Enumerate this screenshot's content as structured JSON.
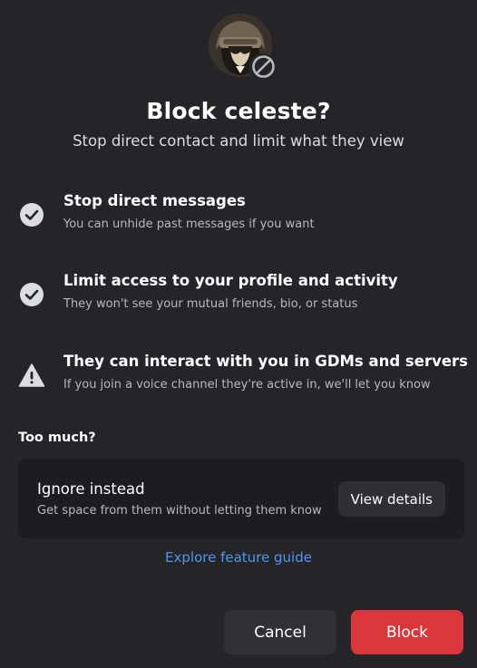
{
  "dialog": {
    "title": "Block celeste?",
    "subtitle": "Stop direct contact and limit what they view"
  },
  "consequences": [
    {
      "icon": "check-circle-icon",
      "title": "Stop direct messages",
      "description": "You can unhide past messages if you want"
    },
    {
      "icon": "check-circle-icon",
      "title": "Limit access to your profile and activity",
      "description": "They won't see your mutual friends, bio, or status"
    },
    {
      "icon": "warning-triangle-icon",
      "title": "They can interact with you in GDMs and servers",
      "description": "If you join a voice channel they're active in, we'll let you know"
    }
  ],
  "alternative": {
    "heading": "Too much?",
    "title": "Ignore instead",
    "description": "Get space from them without letting them know",
    "button_label": "View details"
  },
  "guide_link": "Explore feature guide",
  "actions": {
    "cancel_label": "Cancel",
    "block_label": "Block"
  },
  "colors": {
    "background": "#242429",
    "card": "#1c1c21",
    "link": "#5197ed",
    "danger": "#da373c",
    "icon": "#dbdee1"
  }
}
